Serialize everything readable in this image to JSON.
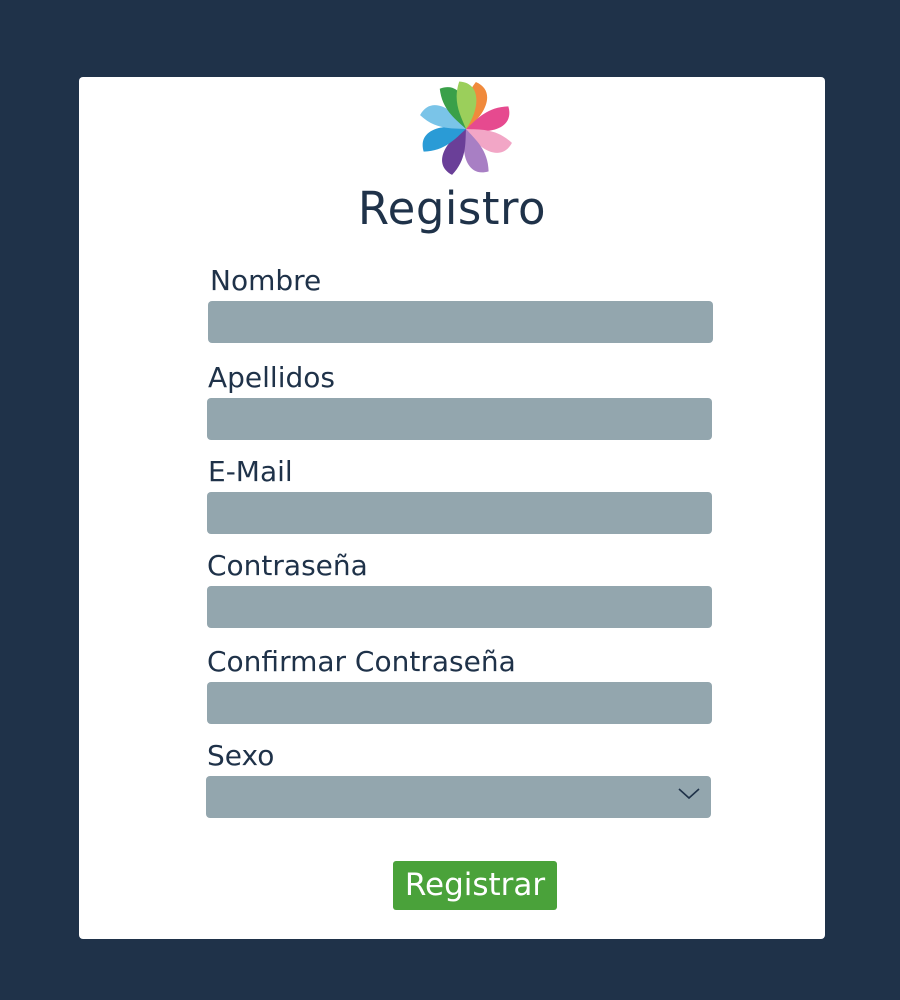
{
  "form": {
    "title": "Registro",
    "fields": {
      "nombre": {
        "label": "Nombre",
        "value": ""
      },
      "apellidos": {
        "label": "Apellidos",
        "value": ""
      },
      "email": {
        "label": "E-Mail",
        "value": ""
      },
      "password": {
        "label": "Contraseña",
        "value": ""
      },
      "confirm_password": {
        "label": "Confirmar Contraseña",
        "value": ""
      },
      "sexo": {
        "label": "Sexo",
        "selected": ""
      }
    },
    "submit_label": "Registrar"
  },
  "icons": {
    "logo": "pinwheel-logo",
    "select_arrow": "chevron-down-icon"
  },
  "colors": {
    "background": "#1f3249",
    "card": "#ffffff",
    "input_fill": "#93a6ae",
    "text": "#1f3249",
    "submit": "#4aa23a"
  }
}
